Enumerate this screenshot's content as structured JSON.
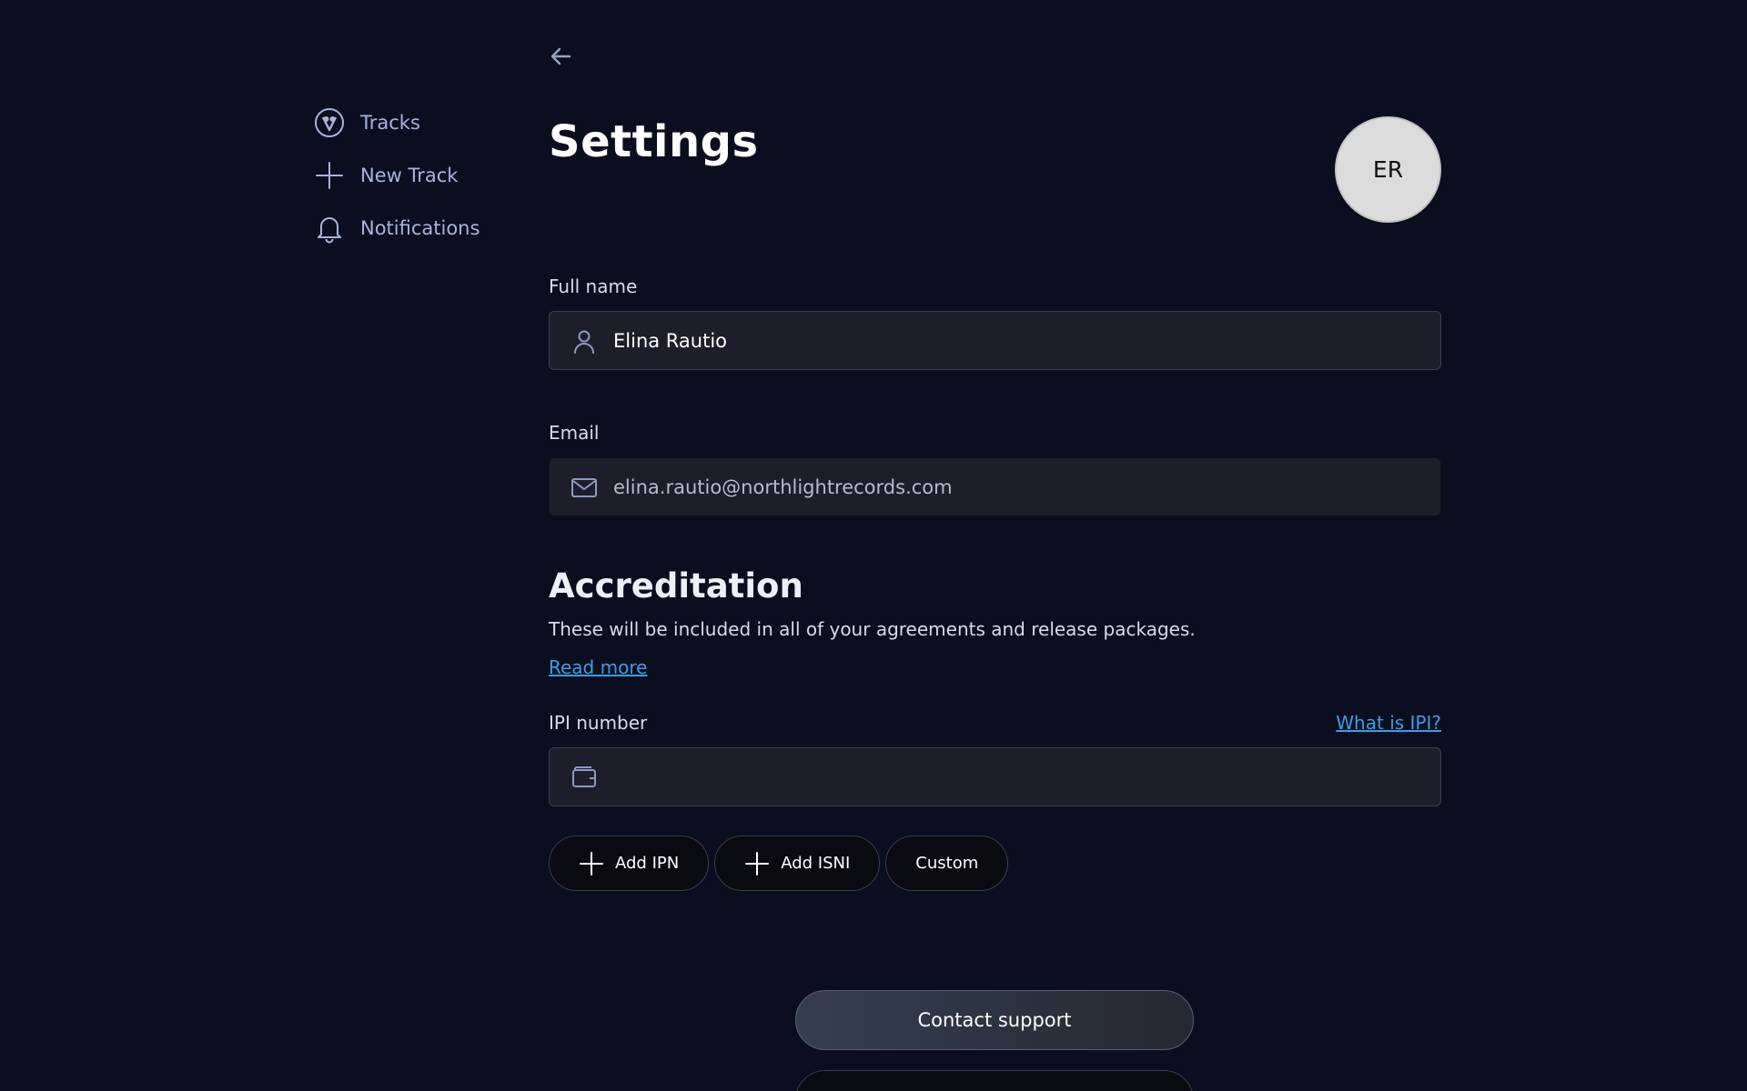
{
  "sidebar": {
    "items": [
      {
        "label": "Tracks",
        "icon": "brand-logo-icon"
      },
      {
        "label": "New Track",
        "icon": "plus-icon"
      },
      {
        "label": "Notifications",
        "icon": "bell-icon"
      }
    ]
  },
  "header": {
    "title": "Settings",
    "avatar_initials": "ER"
  },
  "form": {
    "full_name": {
      "label": "Full name",
      "value": "Elina Rautio",
      "icon": "user-icon"
    },
    "email": {
      "label": "Email",
      "value": "elina.rautio@northlightrecords.com",
      "icon": "mail-icon"
    }
  },
  "accreditation": {
    "title": "Accreditation",
    "description": "These will be included in all of your agreements and release packages.",
    "read_more": "Read more",
    "ipi": {
      "label": "IPI number",
      "help_link": "What is IPI?",
      "value": "",
      "icon": "wallet-icon"
    },
    "actions": [
      {
        "label": "Add IPN",
        "icon": "plus-icon"
      },
      {
        "label": "Add ISNI",
        "icon": "plus-icon"
      },
      {
        "label": "Custom"
      }
    ]
  },
  "footer": {
    "contact_support": "Contact support"
  },
  "colors": {
    "background": "#0a0e1f",
    "link": "#3a9ee8",
    "nav_text": "#aab3da",
    "field_bg": "#1c1f29"
  }
}
